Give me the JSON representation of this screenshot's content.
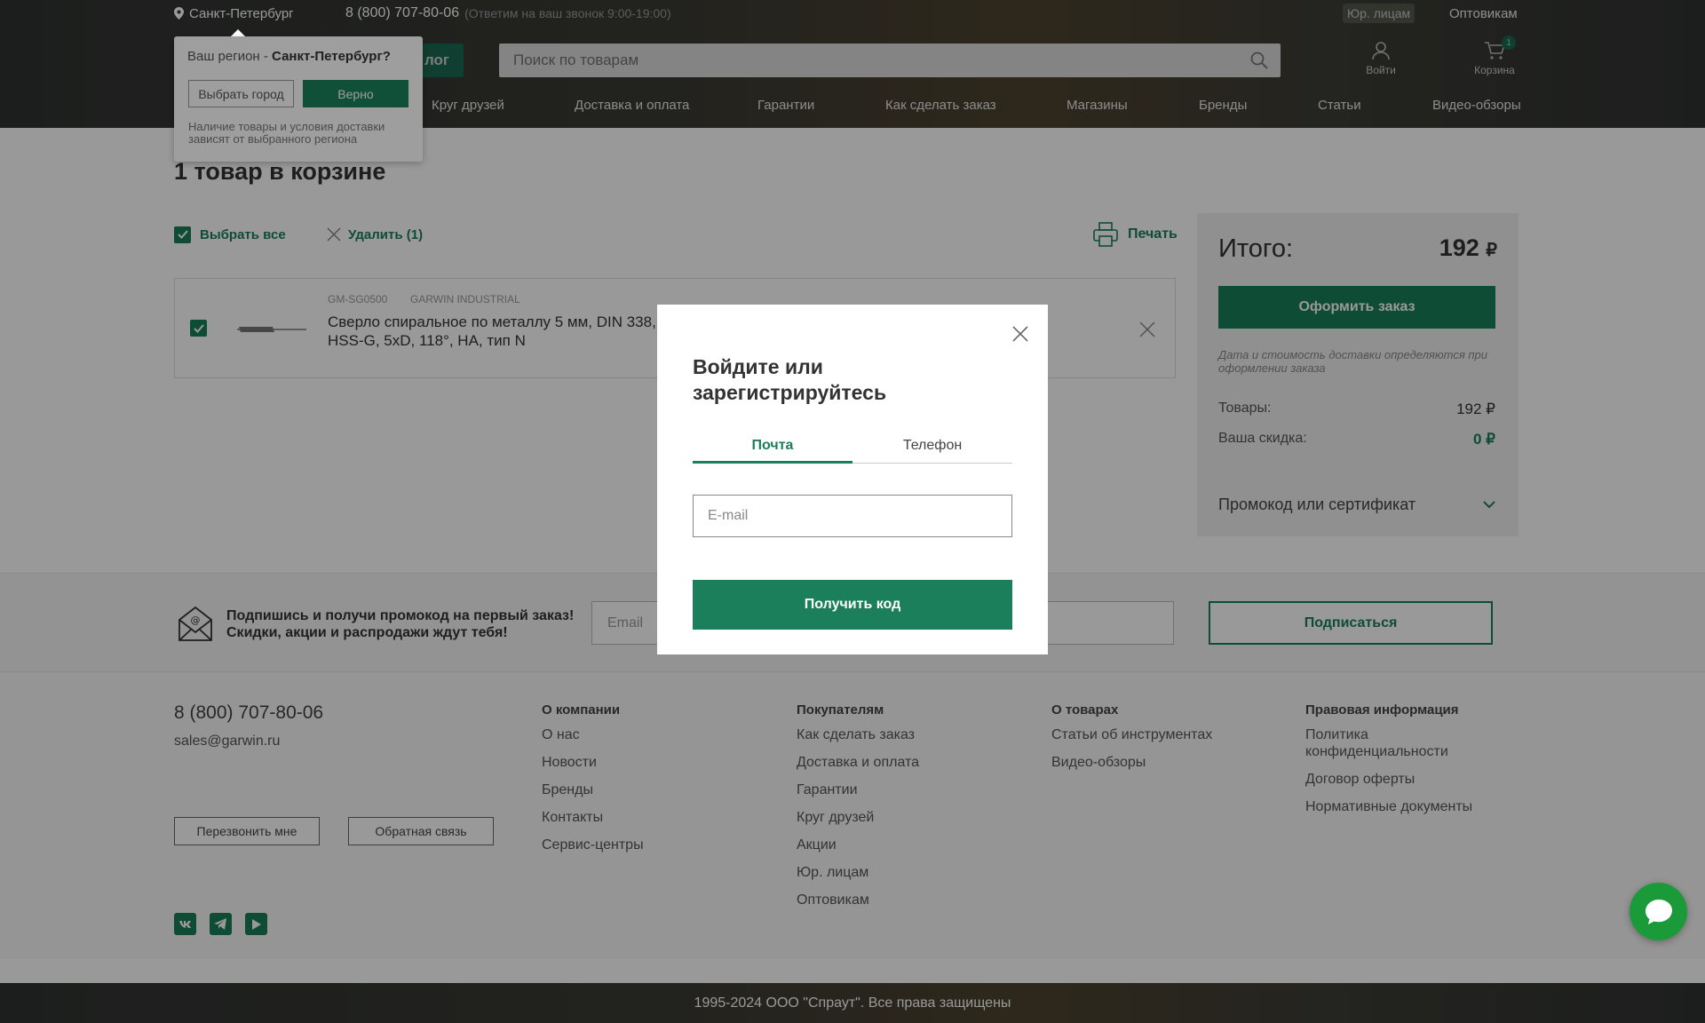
{
  "colors": {
    "accent": "#1a7f5a",
    "header_bg": "#303331",
    "chat": "#1b9a3a"
  },
  "header": {
    "region": "Санкт-Петербург",
    "phone": "8 (800) 707-80-06",
    "hours": "(Ответим на ваш звонок 9:00-19:00)",
    "legal_link": "Юр. лицам",
    "wholesale_link": "Оптовикам",
    "catalog_label": "лог",
    "search_placeholder": "Поиск по товарам",
    "login_label": "Войти",
    "cart_label": "Корзина",
    "cart_count": "1",
    "nav": [
      "Круг друзей",
      "Доставка и оплата",
      "Гарантии",
      "Как сделать заказ",
      "Магазины",
      "Бренды",
      "Статьи",
      "Видео-обзоры"
    ]
  },
  "region_popup": {
    "question_prefix": "Ваш регион - ",
    "question_city": "Санкт-Петербург?",
    "choose_city": "Выбрать город",
    "confirm": "Верно",
    "note": "Наличие товары и условия доставки зависят от выбранного региона"
  },
  "cart": {
    "title": "1 товар в корзине",
    "select_all": "Выбрать все",
    "delete_selected": "Удалить (1)",
    "print": "Печать",
    "items": [
      {
        "sku": "GM-SG0500",
        "brand": "GARWIN INDUSTRIAL",
        "name": "Сверло спиральное по металлу 5 мм, DIN 338, HSS-G, 5xD, 118°, HA, тип N"
      }
    ]
  },
  "summary": {
    "total_label": "Итого:",
    "total_value": "192",
    "currency": "₽",
    "checkout": "Оформить заказ",
    "note": "Дата и стоимость доставки определяются при оформлении заказа",
    "goods_label": "Товары:",
    "goods_value": "192 ₽",
    "discount_label": "Ваша скидка:",
    "discount_value": "0 ₽",
    "promo_label": "Промокод или сертификат"
  },
  "subscribe": {
    "line1": "Подпишись и получи промокод на первый заказ!",
    "line2": "Скидки, акции и распродажи ждут тебя!",
    "email_placeholder": "Email",
    "button": "Подписаться"
  },
  "footer": {
    "phone": "8 (800) 707-80-06",
    "email": "sales@garwin.ru",
    "callback": "Перезвонить мне",
    "feedback": "Обратная связь",
    "columns": [
      {
        "title": "О компании",
        "links": [
          "О нас",
          "Новости",
          "Бренды",
          "Контакты",
          "Сервис-центры"
        ]
      },
      {
        "title": "Покупателям",
        "links": [
          "Как сделать заказ",
          "Доставка и оплата",
          "Гарантии",
          "Круг друзей",
          "Акции",
          "Юр. лицам",
          "Оптовикам"
        ]
      },
      {
        "title": "О товарах",
        "links": [
          "Статьи об инструментах",
          "Видео-обзоры"
        ]
      },
      {
        "title": "Правовая информация",
        "links": [
          "Политика конфиденциальности",
          "Договор оферты",
          "Нормативные документы"
        ]
      }
    ],
    "copyright": "1995-2024 ООО \"Спраут\". Все права защищены"
  },
  "modal": {
    "title": "Войдите или зарегистрируйтесь",
    "tab_mail": "Почта",
    "tab_phone": "Телефон",
    "email_placeholder": "E-mail",
    "submit": "Получить код"
  }
}
